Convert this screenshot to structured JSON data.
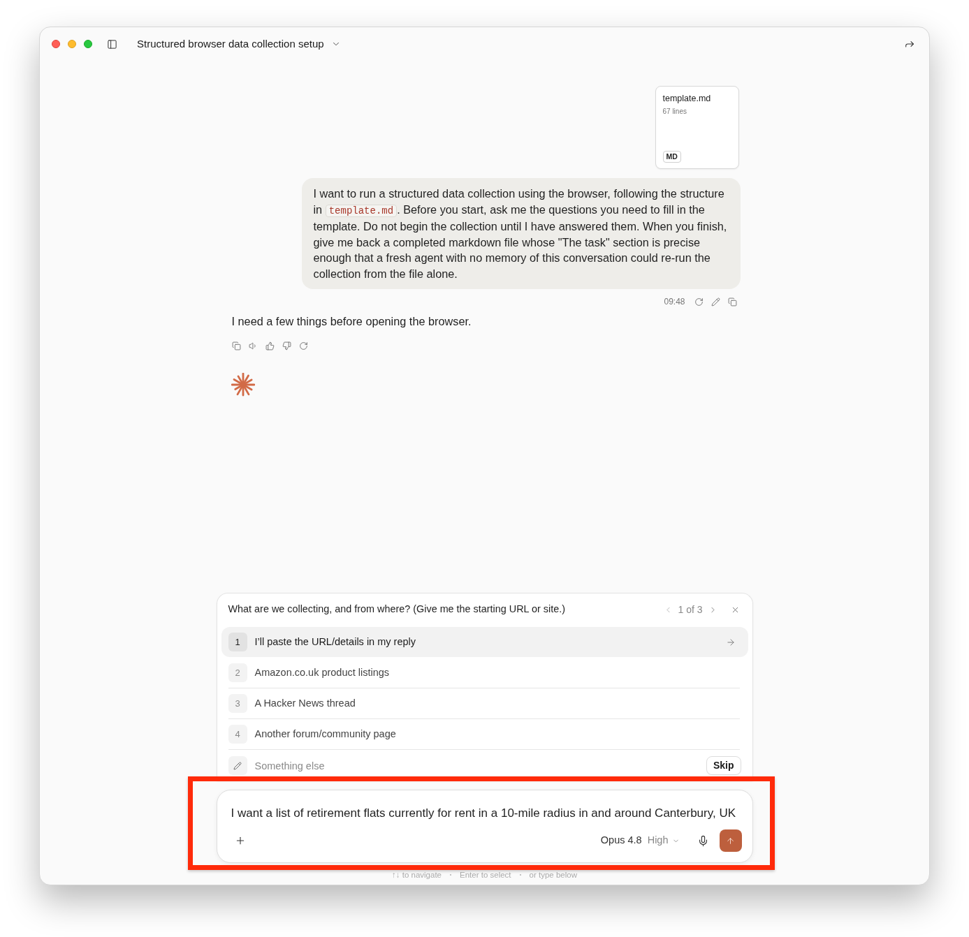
{
  "window": {
    "title": "Structured browser data collection setup"
  },
  "attachment": {
    "name": "template.md",
    "meta": "67 lines",
    "type": "MD"
  },
  "user_message": {
    "parts": [
      {
        "kind": "text",
        "text": "I want to run a structured data collection using the browser, following the structure in "
      },
      {
        "kind": "code",
        "text": "template.md"
      },
      {
        "kind": "text",
        "text": ". Before you start, ask me the questions you need to fill in the template. Do not begin the collection until I have answered them. When you finish, give me back a completed markdown file whose \"The task\" section is precise enough that a fresh agent with no memory of this conversation could re-run the collection from the file alone."
      }
    ],
    "time": "09:48"
  },
  "assistant_message": {
    "text": "I need a few things before opening the browser."
  },
  "question": {
    "text": "What are we collecting, and from where? (Give me the starting URL or site.)",
    "counter": "1 of 3",
    "options": [
      {
        "number": "1",
        "label": "I’ll paste the URL/details in my reply",
        "selected": true
      },
      {
        "number": "2",
        "label": "Amazon.co.uk product listings",
        "selected": false
      },
      {
        "number": "3",
        "label": "A Hacker News thread",
        "selected": false
      },
      {
        "number": "4",
        "label": "Another forum/community page",
        "selected": false
      }
    ],
    "other": {
      "placeholder": "Something else"
    },
    "skip": "Skip"
  },
  "composer": {
    "value": "I want a list of retirement flats currently for rent in a 10-mile radius in and around Canterbury, UK",
    "model": "Opus 4.8",
    "effort": "High"
  },
  "hints": [
    "↑↓ to navigate",
    "Enter to select",
    "or type below"
  ]
}
